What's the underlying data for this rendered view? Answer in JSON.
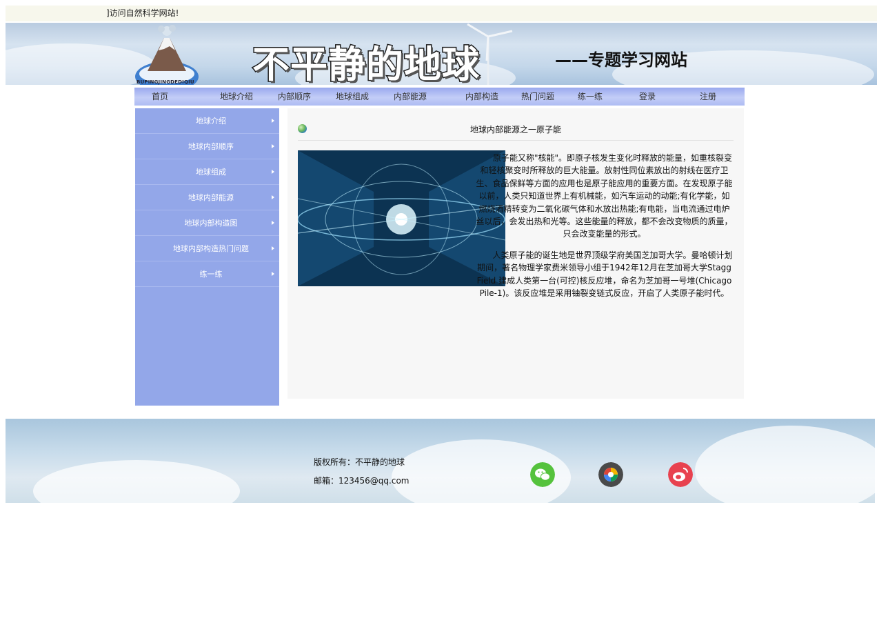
{
  "marquee": {
    "text": "]访问自然科学网站!"
  },
  "banner": {
    "logo_text": "BUPINGJINGDEDIQIU",
    "title": "不平静的地球",
    "subtitle": "——专题学习网站"
  },
  "nav": {
    "items": [
      "首页",
      "地球介绍",
      "内部顺序",
      "地球组成",
      "内部能源",
      "内部构造",
      "热门问题",
      "练一练",
      "登录",
      "注册"
    ]
  },
  "sidebar": {
    "items": [
      "地球介绍",
      "地球内部顺序",
      "地球组成",
      "地球内部能源",
      "地球内部构造图",
      "地球内部构造热门问题",
      "练一练"
    ]
  },
  "article": {
    "title": "地球内部能源之一原子能",
    "paragraph1": "原子能又称\"核能\"。即原子核发生变化时释放的能量，如重核裂变和轻核聚变时所释放的巨大能量。放射性同位素放出的射线在医疗卫生、食品保鲜等方面的应用也是原子能应用的重要方面。在发现原子能以前，人类只知道世界上有机械能，如汽车运动的动能;有化学能，如燃烧酒精转变为二氧化碳气体和水放出热能;有电能，当电流通过电炉丝以后，会发出热和光等。这些能量的释放，都不会改变物质的质量，只会改变能量的形式。",
    "paragraph2": "人类原子能的诞生地是世界顶级学府美国芝加哥大学。曼哈顿计划期间，著名物理学家费米领导小组于1942年12月在芝加哥大学Stagg Field 建成人类第一台(可控)核反应堆，命名为芝加哥一号堆(Chicago Pile-1)。该反应堆是采用铀裂变链式反应，开启了人类原子能时代。"
  },
  "footer": {
    "copyright": "版权所有：不平静的地球",
    "email": "邮箱：123456@qq.com",
    "icons": [
      "wechat-icon",
      "photo-app-icon",
      "weibo-icon"
    ],
    "icon_colors": {
      "wechat": "#55c23d",
      "photo": "#4a4a4a",
      "weibo": "#e8424f"
    }
  }
}
